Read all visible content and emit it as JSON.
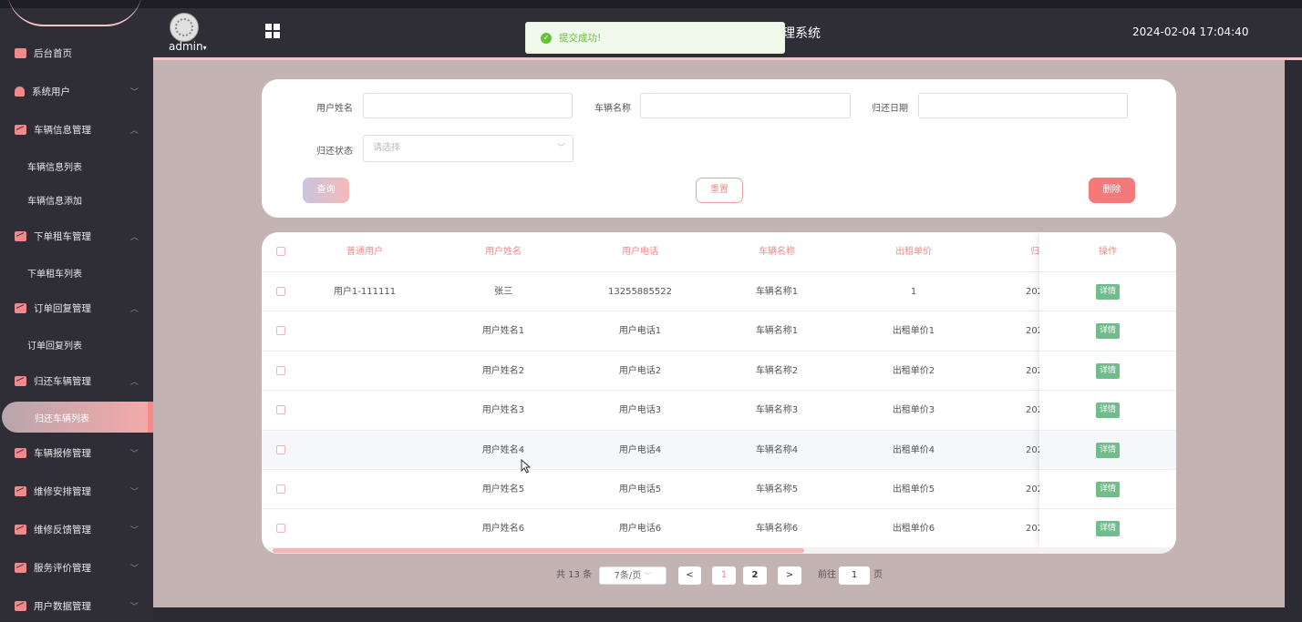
{
  "header": {
    "user": "admin",
    "system_title_fragment": "理系统",
    "datetime": "2024-02-04 17:04:40"
  },
  "toast": {
    "message": "提交成功!"
  },
  "sidebar": {
    "items": [
      {
        "label": "后台首页",
        "icon": "monitor-icon"
      },
      {
        "label": "系统用户",
        "icon": "user-icon"
      },
      {
        "label": "车辆信息管理",
        "icon": "chart-icon"
      },
      {
        "label": "车辆信息列表"
      },
      {
        "label": "车辆信息添加"
      },
      {
        "label": "下单租车管理",
        "icon": "chart-icon"
      },
      {
        "label": "下单租车列表"
      },
      {
        "label": "订单回复管理",
        "icon": "chart-icon"
      },
      {
        "label": "订单回复列表"
      },
      {
        "label": "归还车辆管理",
        "icon": "chart-icon"
      },
      {
        "label": "归还车辆列表"
      },
      {
        "label": "车辆报修管理",
        "icon": "chart-icon"
      },
      {
        "label": "维修安排管理",
        "icon": "chart-icon"
      },
      {
        "label": "维修反馈管理",
        "icon": "chart-icon"
      },
      {
        "label": "服务评价管理",
        "icon": "chart-icon"
      },
      {
        "label": "用户数据管理",
        "icon": "chart-icon"
      }
    ]
  },
  "search": {
    "user_name_label": "用户姓名",
    "vehicle_name_label": "车辆名称",
    "return_date_label": "归还日期",
    "return_status_label": "归还状态",
    "return_status_placeholder": "请选择",
    "query_button": "查询",
    "reset_button": "重置",
    "delete_button": "删除"
  },
  "table": {
    "columns": [
      "普通用户",
      "用户姓名",
      "用户电话",
      "车辆名称",
      "出租单价",
      "归",
      "操作"
    ],
    "detail_label": "详情",
    "rows": [
      {
        "user": "用户1-111111",
        "name": "张三",
        "phone": "13255885522",
        "vehicle": "车辆名称1",
        "price": "1",
        "date": "202"
      },
      {
        "user": "",
        "name": "用户姓名1",
        "phone": "用户电话1",
        "vehicle": "车辆名称1",
        "price": "出租单价1",
        "date": "202"
      },
      {
        "user": "",
        "name": "用户姓名2",
        "phone": "用户电话2",
        "vehicle": "车辆名称2",
        "price": "出租单价2",
        "date": "202"
      },
      {
        "user": "",
        "name": "用户姓名3",
        "phone": "用户电话3",
        "vehicle": "车辆名称3",
        "price": "出租单价3",
        "date": "202"
      },
      {
        "user": "",
        "name": "用户姓名4",
        "phone": "用户电话4",
        "vehicle": "车辆名称4",
        "price": "出租单价4",
        "date": "202"
      },
      {
        "user": "",
        "name": "用户姓名5",
        "phone": "用户电话5",
        "vehicle": "车辆名称5",
        "price": "出租单价5",
        "date": "202"
      },
      {
        "user": "",
        "name": "用户姓名6",
        "phone": "用户电话6",
        "vehicle": "车辆名称6",
        "price": "出租单价6",
        "date": "202"
      }
    ]
  },
  "pagination": {
    "total_text": "共 13 条",
    "page_size": "7条/页",
    "prev": "<",
    "page1": "1",
    "page2": "2",
    "next": ">",
    "goto_label": "前往",
    "goto_value": "1",
    "page_suffix": "页"
  },
  "colors": {
    "accent": "#f08a8a",
    "sidebar_bg": "#2f2e37",
    "main_bg": "#c4b3b3",
    "success": "#67c23a",
    "detail": "#6fbd8a"
  }
}
